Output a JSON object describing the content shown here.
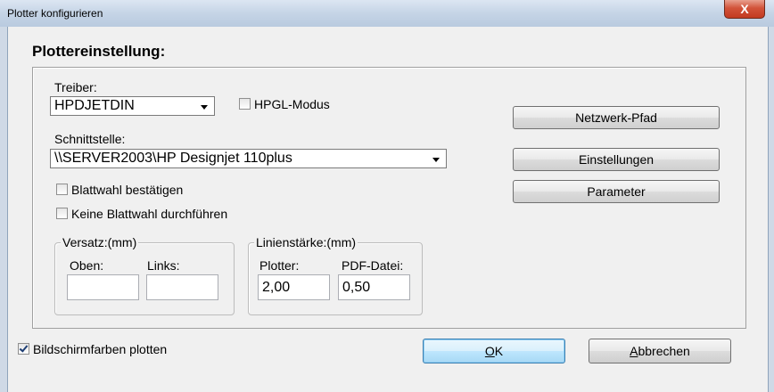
{
  "window": {
    "title": "Plotter konfigurieren",
    "close_label": "X"
  },
  "heading": "Plottereinstellung:",
  "driver": {
    "label": "Treiber:",
    "value": "HPDJETDIN"
  },
  "hpgl": {
    "label": "HPGL-Modus",
    "checked": false
  },
  "interface": {
    "label": "Schnittstelle:",
    "value": "\\\\SERVER2003\\HP Designjet 110plus"
  },
  "checkboxes": {
    "confirm_sheet": {
      "label": "Blattwahl bestätigen",
      "checked": false
    },
    "no_sheet": {
      "label": "Keine Blattwahl durchführen",
      "checked": false
    },
    "screen_colors": {
      "label": "Bildschirmfarben plotten",
      "checked": true
    }
  },
  "buttons": {
    "network_path": "Netzwerk-Pfad",
    "settings": "Einstellungen",
    "parameters": "Parameter",
    "ok_underlined": "O",
    "ok_rest": "K",
    "cancel_underlined": "A",
    "cancel_rest": "bbrechen"
  },
  "offset_group": {
    "legend": "Versatz:(mm)",
    "top_label": "Oben:",
    "left_label": "Links:",
    "top_value": "",
    "left_value": ""
  },
  "line_group": {
    "legend": "Linienstärke:(mm)",
    "plotter_label": "Plotter:",
    "pdf_label": "PDF-Datei:",
    "plotter_value": "2,00",
    "pdf_value": "0,50"
  }
}
